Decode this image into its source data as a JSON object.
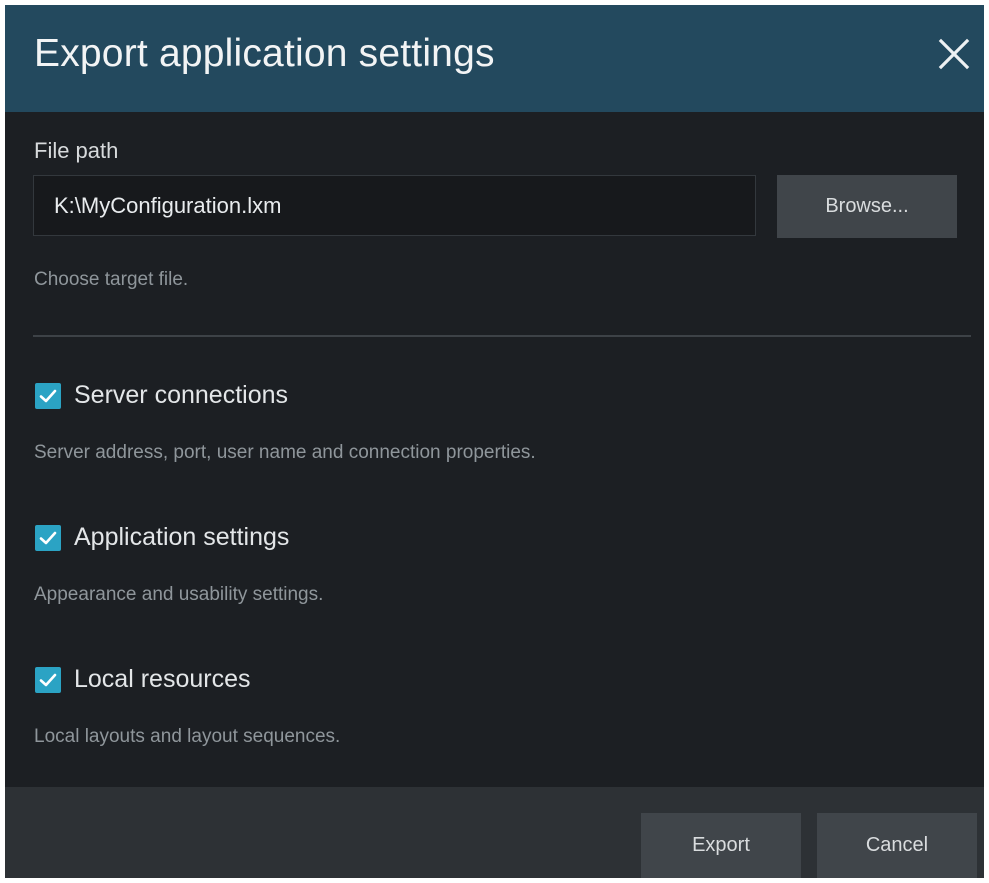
{
  "dialog": {
    "title": "Export application settings",
    "close_icon": "close-icon"
  },
  "file": {
    "label": "File path",
    "value": "K:\\MyConfiguration.lxm",
    "browse_label": "Browse...",
    "hint": "Choose target file."
  },
  "options": [
    {
      "label": "Server connections",
      "checked": true,
      "description": "Server address, port, user name and connection properties."
    },
    {
      "label": "Application settings",
      "checked": true,
      "description": "Appearance and usability settings."
    },
    {
      "label": "Local resources",
      "checked": true,
      "description": "Local layouts and layout sequences."
    }
  ],
  "footer": {
    "export_label": "Export",
    "cancel_label": "Cancel"
  },
  "colors": {
    "title_bar": "#23495e",
    "background": "#1c1f23",
    "footer": "#2d3135",
    "button": "#40454a",
    "checkbox_accent": "#2ba3c4"
  }
}
